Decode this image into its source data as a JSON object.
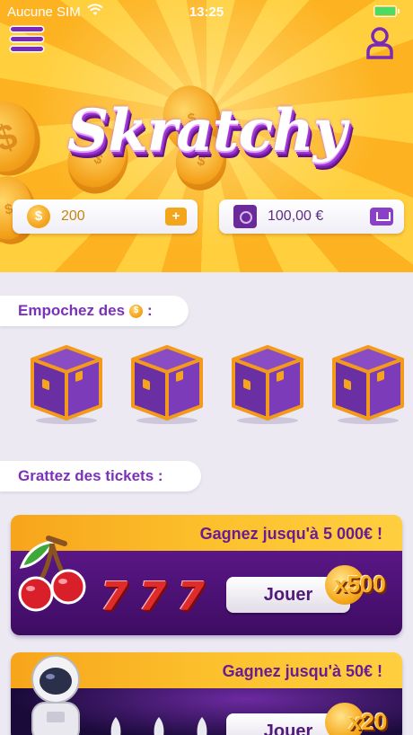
{
  "statusbar": {
    "carrier": "Aucune SIM",
    "time": "13:25"
  },
  "app": {
    "logo": "Skratchy"
  },
  "balances": {
    "coins": "200",
    "coins_add": "+",
    "money": "100,00 €"
  },
  "sections": {
    "chests_label": "Empochez des",
    "chests_label_suffix": ":",
    "tickets_label": "Grattez des tickets :"
  },
  "chests": [
    {
      "id": 1
    },
    {
      "id": 2
    },
    {
      "id": 3
    },
    {
      "id": 4
    }
  ],
  "tickets": [
    {
      "prize": "Gagnez jusqu'à 5 000€ !",
      "symbol": "7",
      "play": "Jouer",
      "multiplier": "x500"
    },
    {
      "prize": "Gagnez jusqu'à 50€ !",
      "play": "Jouer",
      "multiplier": "x20"
    }
  ],
  "colors": {
    "accent": "#7b32ba",
    "gold": "#f4a11c",
    "hero_bg": "#fdb321",
    "page_bg": "#ece9f3"
  }
}
